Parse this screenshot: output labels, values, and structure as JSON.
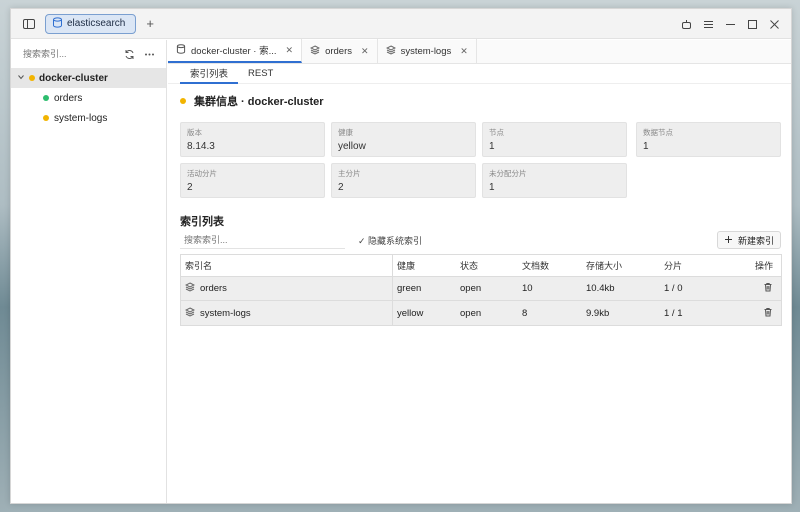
{
  "titlebar": {
    "app_tab_label": "elasticsearch",
    "add_tab_glyph": "+"
  },
  "sidebar": {
    "search_placeholder": "搜索索引...",
    "cluster": {
      "name": "docker-cluster",
      "status_color": "#f2b400"
    },
    "items": [
      {
        "label": "orders",
        "status_color": "#2dbd6e"
      },
      {
        "label": "system-logs",
        "status_color": "#f2b400"
      }
    ]
  },
  "doc_tabs": [
    {
      "label": "docker-cluster · 索...",
      "icon": "database-icon"
    },
    {
      "label": "orders",
      "icon": "layers-icon"
    },
    {
      "label": "system-logs",
      "icon": "layers-icon"
    }
  ],
  "sub_tabs": [
    "索引列表",
    "REST"
  ],
  "cluster_info": {
    "title": "集群信息 · docker-cluster",
    "status_color": "#f2b400",
    "cards": [
      {
        "label": "版本",
        "value": "8.14.3"
      },
      {
        "label": "健康",
        "value": "yellow"
      },
      {
        "label": "节点",
        "value": "1"
      },
      {
        "label": "数据节点",
        "value": "1"
      },
      {
        "label": "活动分片",
        "value": "2"
      },
      {
        "label": "主分片",
        "value": "2"
      },
      {
        "label": "未分配分片",
        "value": "1"
      }
    ]
  },
  "index_list": {
    "title": "索引列表",
    "search_placeholder": "搜索索引...",
    "hide_system_label": "✓ 隐藏系统索引",
    "new_index_label": "新建索引",
    "columns": [
      "索引名",
      "健康",
      "状态",
      "文档数",
      "存储大小",
      "分片",
      "操作"
    ],
    "rows": [
      {
        "name": "orders",
        "health": "green",
        "status": "open",
        "docs": "10",
        "size": "10.4kb",
        "shards": "1 / 0"
      },
      {
        "name": "system-logs",
        "health": "yellow",
        "status": "open",
        "docs": "8",
        "size": "9.9kb",
        "shards": "1 / 1"
      }
    ]
  },
  "colors": {
    "accent": "#2f6fd1",
    "green": "#2dbd6e",
    "yellow": "#f2b400"
  }
}
